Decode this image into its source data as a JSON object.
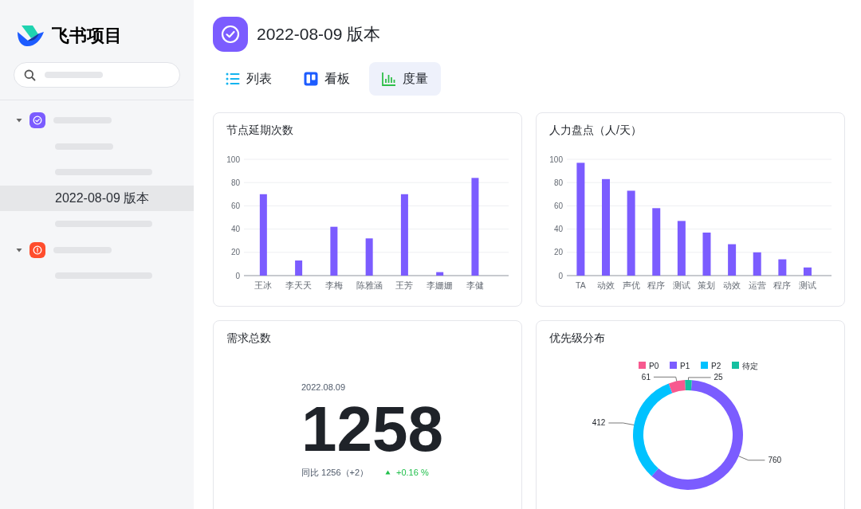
{
  "sidebar": {
    "brand": "飞书项目",
    "tree": [
      {
        "kind": "group",
        "color": "#7b5cff",
        "expanded": true,
        "selected": false,
        "children": [
          {
            "kind": "stub",
            "selected": false
          },
          {
            "kind": "skeleton",
            "selected": false
          },
          {
            "kind": "label",
            "text": "2022-08-09 版本",
            "selected": true
          },
          {
            "kind": "skeleton",
            "selected": false
          }
        ]
      },
      {
        "kind": "group",
        "color": "#ff4d2d",
        "expanded": true,
        "selected": false,
        "children": [
          {
            "kind": "skeleton",
            "selected": false
          }
        ]
      }
    ]
  },
  "header": {
    "title": "2022-08-09 版本"
  },
  "tabs": [
    {
      "label": "列表",
      "selected": false
    },
    {
      "label": "看板",
      "selected": false
    },
    {
      "label": "度量",
      "selected": true
    }
  ],
  "cards": [
    {
      "kind": "chart",
      "title": "节点延期次数",
      "chart_data": {
        "type": "bar",
        "categories": [
          "王冰",
          "李天天",
          "李梅",
          "陈雅涵",
          "王芳",
          "李姗姗",
          "李健"
        ],
        "series": [
          {
            "color": "#7b5cff",
            "values": [
              70,
              13,
              42,
              32,
              70,
              3,
              84
            ]
          }
        ],
        "ylim": [
          0,
          100
        ],
        "yticks": [
          0,
          20,
          40,
          60,
          80,
          100
        ],
        "grid": true
      }
    },
    {
      "kind": "chart",
      "title": "人力盘点（人/天）",
      "chart_data": {
        "type": "bar",
        "categories": [
          "TA",
          "动效",
          "声优",
          "程序",
          "测试",
          "策划",
          "动效",
          "运营",
          "程序",
          "测试"
        ],
        "series": [
          {
            "color": "#7b5cff",
            "values": [
              97,
              83,
              73,
              58,
              47,
              37,
              27,
              20,
              14,
              7
            ]
          }
        ],
        "ylim": [
          0,
          100
        ],
        "yticks": [
          0,
          20,
          40,
          60,
          80,
          100
        ],
        "grid": true
      }
    },
    {
      "kind": "total",
      "title": "需求总数",
      "date": "2022.08.09",
      "value": "1258",
      "comparison": "同比 1256（+2）",
      "change": "+0.16 %"
    },
    {
      "kind": "chart",
      "title": "优先级分布",
      "chart_data": {
        "type": "donut",
        "categories": [
          "P0",
          "P1",
          "P2",
          "待定"
        ],
        "values": [
          61,
          760,
          412,
          25
        ],
        "colors": [
          "#f7598f",
          "#7b5cff",
          "#00c2ff",
          "#14c0a0"
        ],
        "value_labels": [
          "61",
          "760",
          "412",
          "25"
        ],
        "legend": true
      }
    }
  ]
}
